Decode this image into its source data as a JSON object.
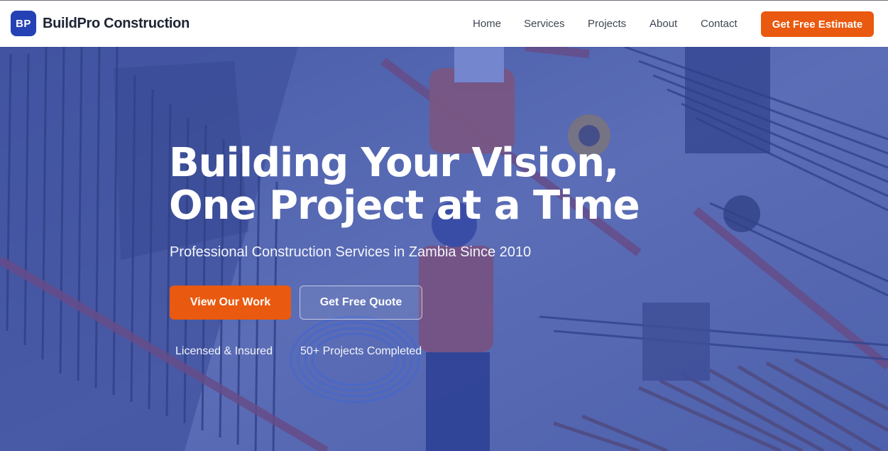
{
  "brand": {
    "logo_initials": "BP",
    "name": "BuildPro Construction",
    "logo_color": "#2442b3"
  },
  "nav": {
    "items": [
      "Home",
      "Services",
      "Projects",
      "About",
      "Contact"
    ],
    "cta_label": "Get Free Estimate"
  },
  "hero": {
    "title_line1": "Building Your Vision,",
    "title_line2": "One Project at a Time",
    "subtitle": "Professional Construction Services in Zambia Since 2010",
    "primary_button": "View Our Work",
    "secondary_button": "Get Free Quote",
    "trust_badges": [
      "Licensed & Insured",
      "50+ Projects Completed"
    ],
    "background_image": "construction-site-photo"
  },
  "colors": {
    "accent": "#e9590f",
    "brand_blue": "#2442b3",
    "hero_overlay": "#344ebe"
  }
}
